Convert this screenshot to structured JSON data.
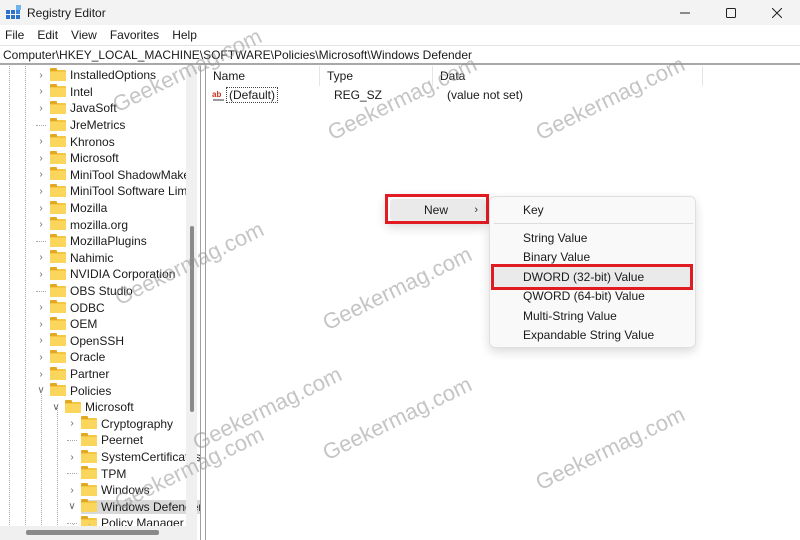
{
  "window": {
    "title": "Registry Editor",
    "icon": "registry-editor-icon",
    "controls": {
      "minimize": "minimize-icon",
      "maximize": "maximize-icon",
      "close": "close-icon"
    }
  },
  "menubar": [
    "File",
    "Edit",
    "View",
    "Favorites",
    "Help"
  ],
  "address": "Computer\\HKEY_LOCAL_MACHINE\\SOFTWARE\\Policies\\Microsoft\\Windows Defender",
  "tree": {
    "items": [
      {
        "label": "InstalledOptions",
        "expander": "collapsed"
      },
      {
        "label": "Intel",
        "expander": "collapsed"
      },
      {
        "label": "JavaSoft",
        "expander": "collapsed"
      },
      {
        "label": "JreMetrics",
        "expander": "none"
      },
      {
        "label": "Khronos",
        "expander": "collapsed"
      },
      {
        "label": "Microsoft",
        "expander": "collapsed"
      },
      {
        "label": "MiniTool ShadowMaker",
        "expander": "collapsed"
      },
      {
        "label": "MiniTool Software Limit",
        "expander": "collapsed"
      },
      {
        "label": "Mozilla",
        "expander": "collapsed"
      },
      {
        "label": "mozilla.org",
        "expander": "collapsed"
      },
      {
        "label": "MozillaPlugins",
        "expander": "none"
      },
      {
        "label": "Nahimic",
        "expander": "collapsed"
      },
      {
        "label": "NVIDIA Corporation",
        "expander": "collapsed"
      },
      {
        "label": "OBS Studio",
        "expander": "none"
      },
      {
        "label": "ODBC",
        "expander": "collapsed"
      },
      {
        "label": "OEM",
        "expander": "collapsed"
      },
      {
        "label": "OpenSSH",
        "expander": "collapsed"
      },
      {
        "label": "Oracle",
        "expander": "collapsed"
      },
      {
        "label": "Partner",
        "expander": "collapsed"
      },
      {
        "label": "Policies",
        "expander": "expanded"
      },
      {
        "label": "Microsoft",
        "expander": "expanded"
      },
      {
        "label": "Cryptography",
        "expander": "collapsed"
      },
      {
        "label": "Peernet",
        "expander": "none"
      },
      {
        "label": "SystemCertificates",
        "expander": "collapsed"
      },
      {
        "label": "TPM",
        "expander": "none"
      },
      {
        "label": "Windows",
        "expander": "collapsed"
      },
      {
        "label": "Windows Defender",
        "expander": "expanded",
        "selected": true
      },
      {
        "label": "Policy Manager",
        "expander": "none"
      }
    ]
  },
  "list": {
    "columns": [
      "Name",
      "Type",
      "Data"
    ],
    "rows": [
      {
        "name": "(Default)",
        "type": "REG_SZ",
        "data": "(value not set)",
        "icon": "string-value-icon"
      }
    ]
  },
  "context_menu": {
    "new_label": "New",
    "submenu": [
      "Key",
      "String Value",
      "Binary Value",
      "DWORD (32-bit) Value",
      "QWORD (64-bit) Value",
      "Multi-String Value",
      "Expandable String Value"
    ],
    "highlighted": "DWORD (32-bit) Value"
  },
  "watermark": "Geekermag.com",
  "colors": {
    "highlight_box": "#e21b23",
    "folder": "#f5c642",
    "selection": "#d9d9d9"
  }
}
